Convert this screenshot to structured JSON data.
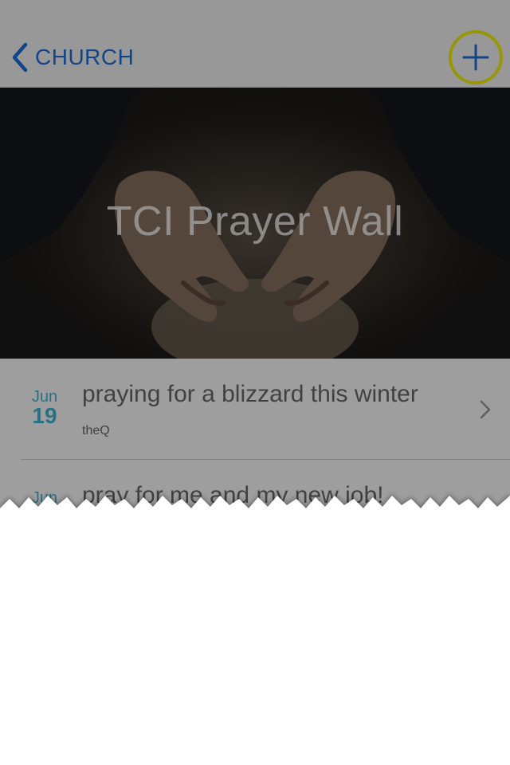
{
  "navbar": {
    "back_label": "CHURCH",
    "add_icon": "plus-icon",
    "highlight_color": "#f2f20c",
    "tint_color": "#1f6fd8"
  },
  "hero": {
    "title": "TCI Prayer Wall"
  },
  "prayers": [
    {
      "month": "Jun",
      "day": "19",
      "title": "praying for a blizzard this winter",
      "author": "theQ"
    },
    {
      "month": "Jun",
      "day": "",
      "title": "pray for me and my new job!",
      "author": ""
    }
  ],
  "colors": {
    "date_accent": "#3fb6d6",
    "text": "#6a6a6a"
  }
}
